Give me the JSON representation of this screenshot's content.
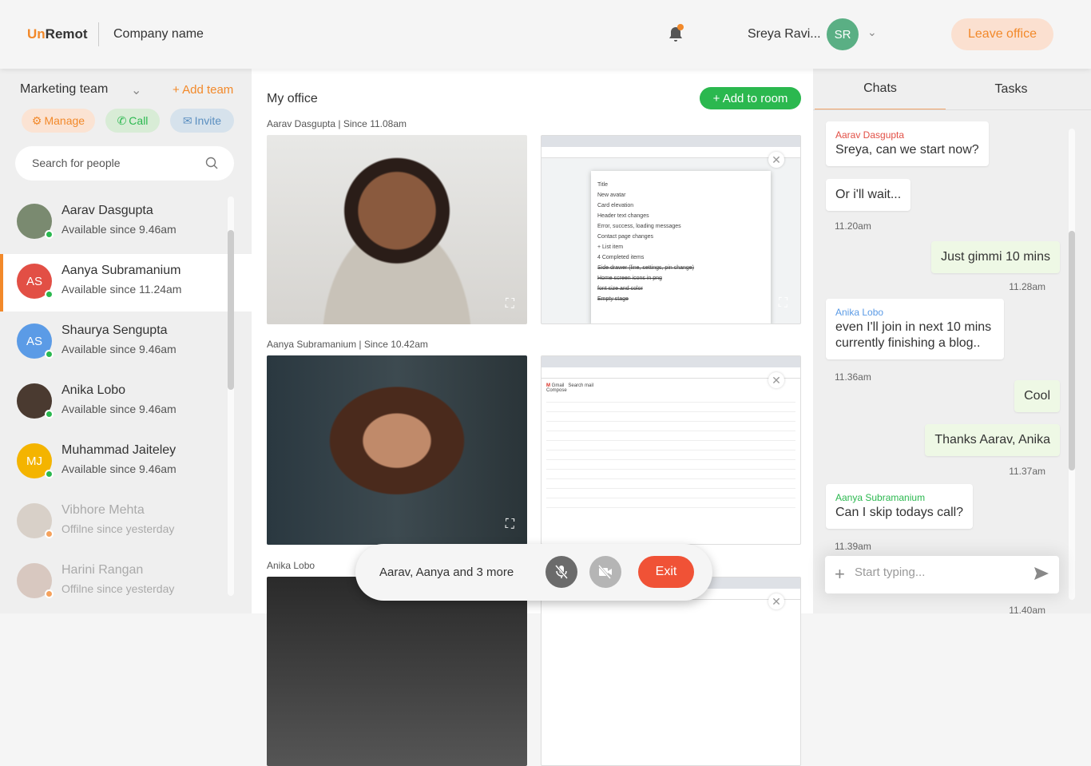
{
  "header": {
    "logo_un": "Un",
    "logo_rest": "Remot",
    "company": "Company name",
    "user_name": "Sreya Ravi...",
    "user_initials": "SR",
    "leave_label": "Leave office"
  },
  "sidebar": {
    "team": "Marketing team",
    "add_team": "+ Add team",
    "manage": "Manage",
    "call": "Call",
    "invite": "Invite",
    "search_placeholder": "Search for people",
    "contacts": [
      {
        "name": "Aarav Dasgupta",
        "status": "Available since 9.46am",
        "initials": "",
        "color": "#7a8a70",
        "online": true
      },
      {
        "name": "Aanya Subramanium",
        "status": "Available since 11.24am",
        "initials": "AS",
        "color": "#e24f45",
        "online": true
      },
      {
        "name": "Shaurya Sengupta",
        "status": "Available since 9.46am",
        "initials": "AS",
        "color": "#5b9be6",
        "online": true
      },
      {
        "name": "Anika Lobo",
        "status": "Available since 9.46am",
        "initials": "",
        "color": "#4a3a30",
        "online": true
      },
      {
        "name": "Muhammad Jaiteley",
        "status": "Available since 9.46am",
        "initials": "MJ",
        "color": "#f4b400",
        "online": true
      },
      {
        "name": "Vibhore Mehta",
        "status": "Offilne since yesterday",
        "initials": "",
        "color": "#d8d0c8",
        "online": false
      },
      {
        "name": "Harini Rangan",
        "status": "Offilne since yesterday",
        "initials": "",
        "color": "#d8c8c0",
        "online": false
      }
    ]
  },
  "main": {
    "title": "My office",
    "add_room": "+ Add to room",
    "participants": [
      {
        "label": "Aarav Dasgupta  |  Since 11.08am"
      },
      {
        "label": "Aanya Subramanium  |  Since 10.42am"
      },
      {
        "label": "Anika Lobo"
      }
    ],
    "keep": {
      "title": "Title",
      "items": [
        "New avatar",
        "Card elevation",
        "Header text changes",
        "Error, success, loading messages",
        "Contact page changes",
        "+ List item",
        "4 Completed items",
        "Side drawer (line, settings, pin change)",
        "Home screen icons in png",
        "font size and color",
        "Empty stage"
      ]
    },
    "gmail": {
      "app": "Gmail",
      "search": "Search mail",
      "compose": "Compose"
    }
  },
  "callbar": {
    "text": "Aarav, Aanya and 3 more",
    "exit": "Exit"
  },
  "chat": {
    "tabs": [
      "Chats",
      "Tasks"
    ],
    "messages": [
      {
        "dir": "in",
        "who": "Aarav Dasgupta",
        "who_color": "#e24f45",
        "text": "Sreya, can we start now?"
      },
      {
        "dir": "in",
        "text": "Or i'll wait..."
      },
      {
        "dir": "out",
        "text": "Just gimmi 10 mins"
      },
      {
        "dir": "in",
        "who": "Anika Lobo",
        "who_color": "#5b9be6",
        "text": "even I'll join in next 10 mins currently finishing a blog.."
      },
      {
        "dir": "out",
        "text": "Cool"
      },
      {
        "dir": "out",
        "text": "Thanks Aarav, Anika"
      },
      {
        "dir": "in",
        "who": "Aanya Subramanium",
        "who_color": "#2bb84f",
        "text": "Can I skip todays call?"
      }
    ],
    "times": [
      "11.20am",
      "11.28am",
      "11.36am",
      "11.37am",
      "11.39am",
      "11.40am"
    ],
    "placeholder": "Start typing..."
  },
  "colors": {
    "accent": "#f2892a",
    "green": "#2bb84f",
    "exit": "#f05236"
  }
}
